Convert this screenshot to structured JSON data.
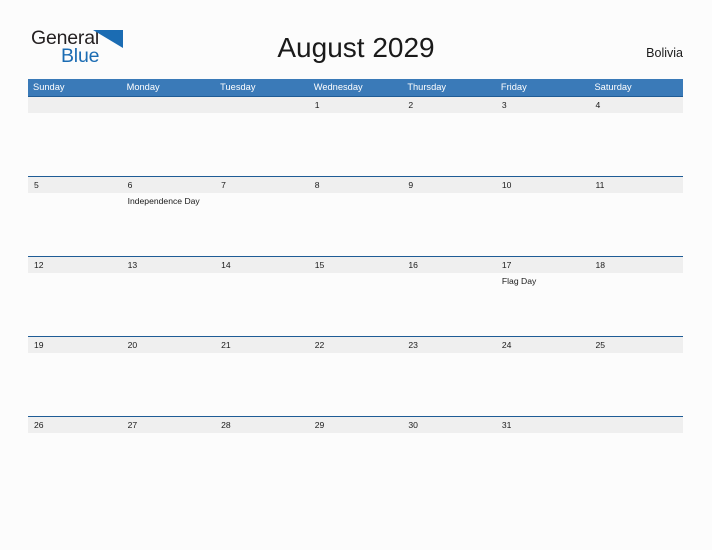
{
  "brand": {
    "name_part1": "General",
    "name_part2": "Blue",
    "flag_icon": "triangle-flag-icon",
    "color_dark": "#231f20",
    "color_blue": "#1b6cb3"
  },
  "header": {
    "title": "August 2029",
    "country": "Bolivia"
  },
  "theme": {
    "header_bar": "#3a7ab8",
    "week_rule": "#1f5c96",
    "date_band": "#efefef",
    "page_background": "#fcfcfc",
    "text": "#1a1a1a"
  },
  "calendar": {
    "month": "August",
    "year": "2029",
    "weekdays": [
      "Sunday",
      "Monday",
      "Tuesday",
      "Wednesday",
      "Thursday",
      "Friday",
      "Saturday"
    ],
    "weeks": [
      {
        "days": [
          {
            "num": "",
            "event": ""
          },
          {
            "num": "",
            "event": ""
          },
          {
            "num": "",
            "event": ""
          },
          {
            "num": "1",
            "event": ""
          },
          {
            "num": "2",
            "event": ""
          },
          {
            "num": "3",
            "event": ""
          },
          {
            "num": "4",
            "event": ""
          }
        ]
      },
      {
        "days": [
          {
            "num": "5",
            "event": ""
          },
          {
            "num": "6",
            "event": "Independence Day"
          },
          {
            "num": "7",
            "event": ""
          },
          {
            "num": "8",
            "event": ""
          },
          {
            "num": "9",
            "event": ""
          },
          {
            "num": "10",
            "event": ""
          },
          {
            "num": "11",
            "event": ""
          }
        ]
      },
      {
        "days": [
          {
            "num": "12",
            "event": ""
          },
          {
            "num": "13",
            "event": ""
          },
          {
            "num": "14",
            "event": ""
          },
          {
            "num": "15",
            "event": ""
          },
          {
            "num": "16",
            "event": ""
          },
          {
            "num": "17",
            "event": "Flag Day"
          },
          {
            "num": "18",
            "event": ""
          }
        ]
      },
      {
        "days": [
          {
            "num": "19",
            "event": ""
          },
          {
            "num": "20",
            "event": ""
          },
          {
            "num": "21",
            "event": ""
          },
          {
            "num": "22",
            "event": ""
          },
          {
            "num": "23",
            "event": ""
          },
          {
            "num": "24",
            "event": ""
          },
          {
            "num": "25",
            "event": ""
          }
        ]
      },
      {
        "days": [
          {
            "num": "26",
            "event": ""
          },
          {
            "num": "27",
            "event": ""
          },
          {
            "num": "28",
            "event": ""
          },
          {
            "num": "29",
            "event": ""
          },
          {
            "num": "30",
            "event": ""
          },
          {
            "num": "31",
            "event": ""
          },
          {
            "num": "",
            "event": ""
          }
        ]
      }
    ]
  }
}
